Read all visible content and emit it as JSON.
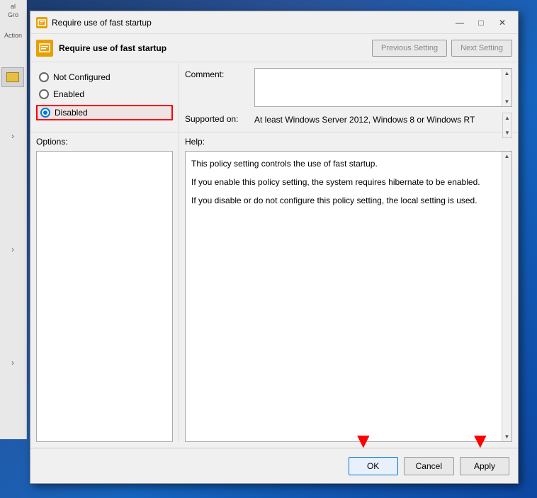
{
  "dialog": {
    "title": "Require use of fast startup",
    "header_title": "Require use of fast startup",
    "prev_btn": "Previous Setting",
    "next_btn": "Next Setting"
  },
  "radio_options": [
    {
      "id": "not-configured",
      "label": "Not Configured",
      "selected": false,
      "highlighted": false
    },
    {
      "id": "enabled",
      "label": "Enabled",
      "selected": false,
      "highlighted": false
    },
    {
      "id": "disabled",
      "label": "Disabled",
      "selected": true,
      "highlighted": true
    }
  ],
  "info": {
    "comment_label": "Comment:",
    "supported_label": "Supported on:",
    "supported_text": "At least Windows Server 2012, Windows 8 or Windows RT"
  },
  "sections": {
    "options_label": "Options:",
    "help_label": "Help:"
  },
  "help_text": [
    "This policy setting controls the use of fast startup.",
    "If you enable this policy setting, the system requires hibernate to be enabled.",
    "If you disable or do not configure this policy setting, the local setting is used."
  ],
  "footer": {
    "ok_label": "OK",
    "cancel_label": "Cancel",
    "apply_label": "Apply"
  },
  "titlebar": {
    "minimize": "—",
    "maximize": "□",
    "close": "✕"
  },
  "sidebar": {
    "label1": "al Gro",
    "label2": "Action",
    "arrows": [
      "›",
      "›",
      "›"
    ]
  }
}
